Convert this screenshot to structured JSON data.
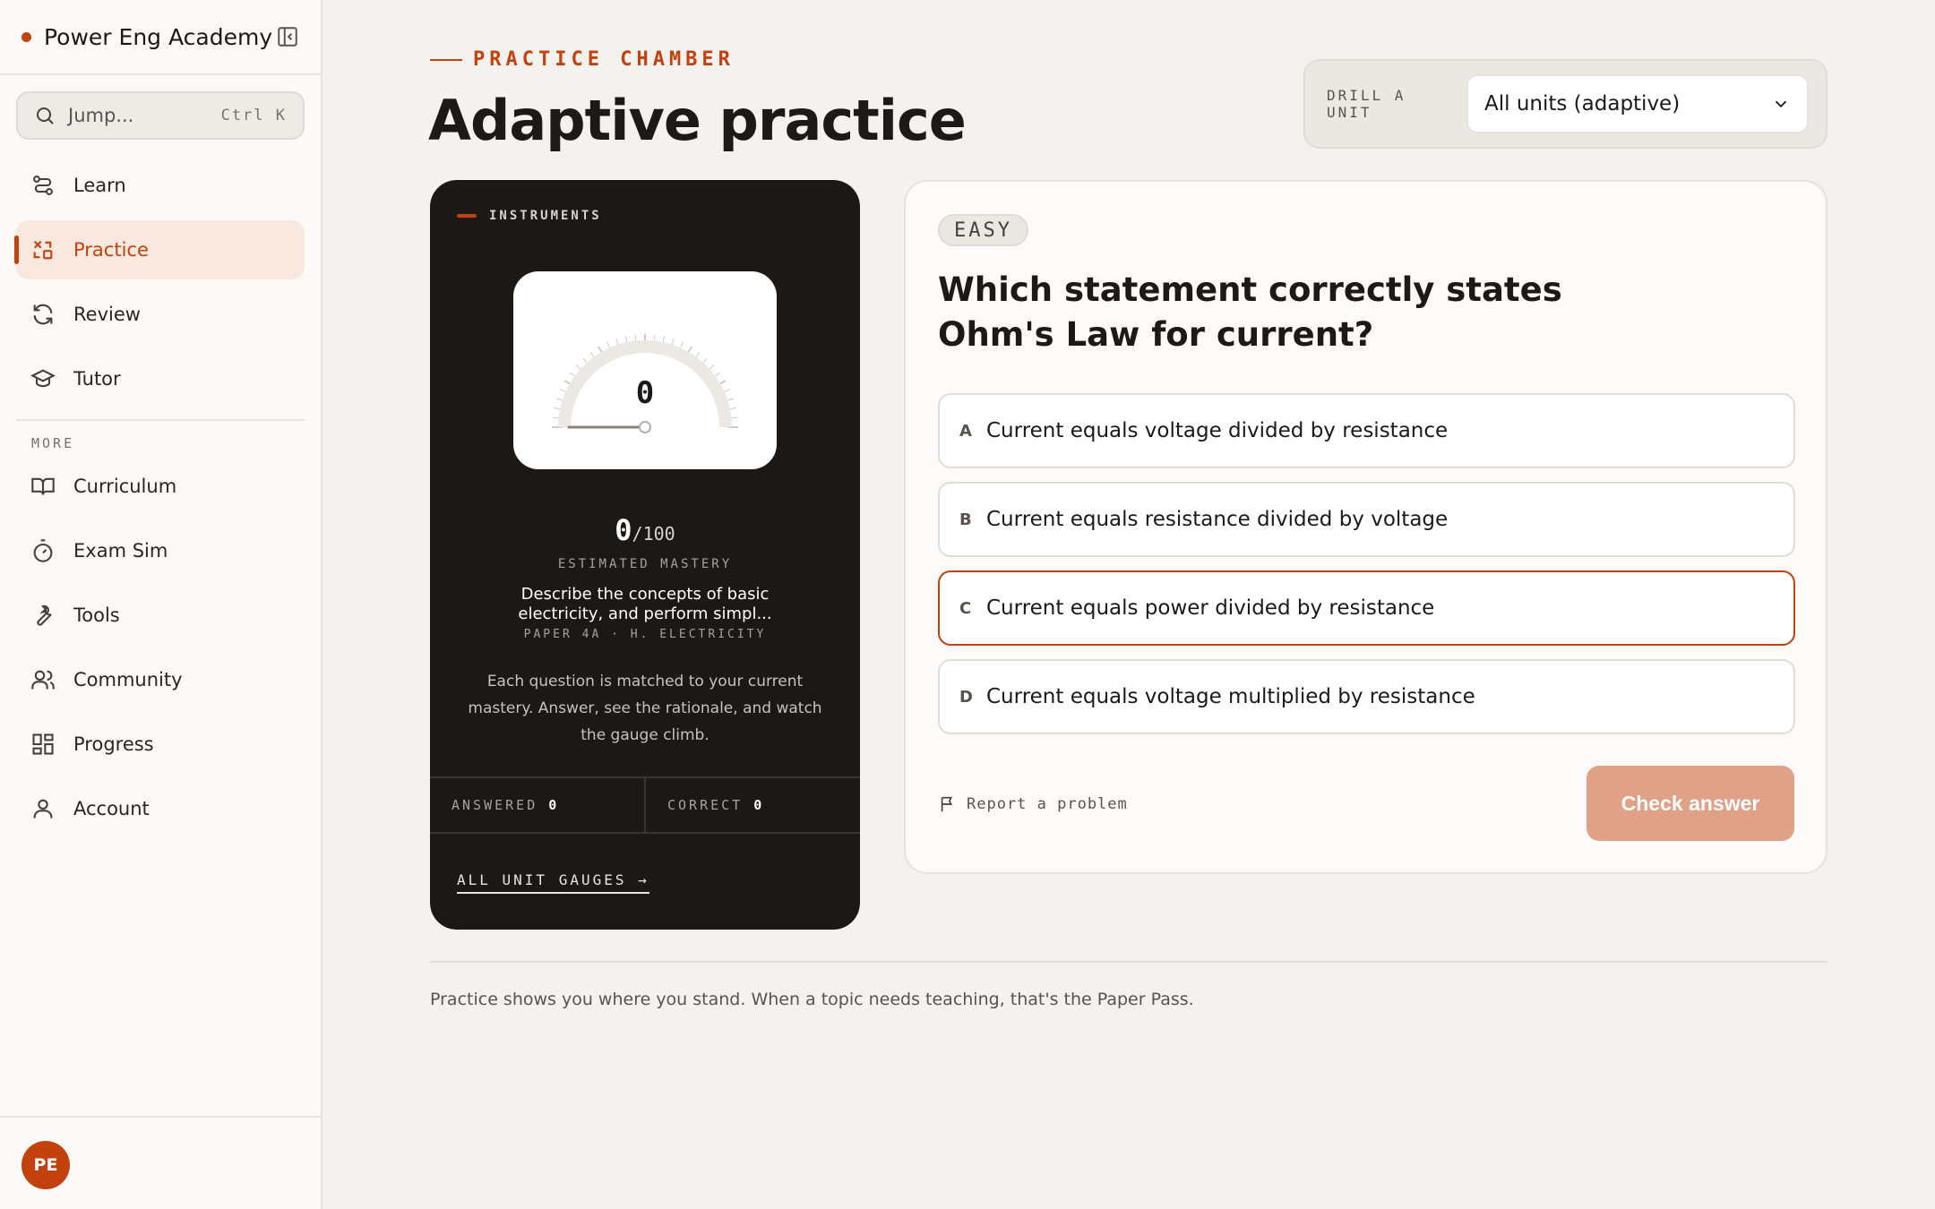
{
  "app": {
    "name": "Power Eng Academy",
    "user_initials": "PE"
  },
  "search": {
    "placeholder": "Jump...",
    "shortcut": "Ctrl K"
  },
  "nav": {
    "primary": [
      {
        "label": "Learn",
        "icon": "route-icon"
      },
      {
        "label": "Practice",
        "icon": "practice-icon",
        "active": true
      },
      {
        "label": "Review",
        "icon": "refresh-icon"
      },
      {
        "label": "Tutor",
        "icon": "graduation-cap-icon"
      }
    ],
    "more_label": "MORE",
    "secondary": [
      {
        "label": "Curriculum",
        "icon": "book-open-icon"
      },
      {
        "label": "Exam Sim",
        "icon": "timer-icon"
      },
      {
        "label": "Tools",
        "icon": "wrench-icon"
      },
      {
        "label": "Community",
        "icon": "users-icon"
      },
      {
        "label": "Progress",
        "icon": "dashboard-icon"
      },
      {
        "label": "Account",
        "icon": "user-icon"
      }
    ]
  },
  "header": {
    "eyebrow": "PRACTICE CHAMBER",
    "title": "Adaptive practice",
    "drill_label": "DRILL A UNIT",
    "drill_value": "All units (adaptive)"
  },
  "instruments": {
    "title": "INSTRUMENTS",
    "gauge_value": "0",
    "gauge_fraction": 0,
    "score": "0",
    "score_max": "/100",
    "mastery_label": "ESTIMATED MASTERY",
    "unit_description": "Describe the concepts of basic electricity, and perform simpl...",
    "unit_code": "PAPER 4A · H. ELECTRICITY",
    "note": "Each question is matched to your current mastery. Answer, see the rationale, and watch the gauge climb.",
    "answered_label": "ANSWERED",
    "answered_value": "0",
    "correct_label": "CORRECT",
    "correct_value": "0",
    "all_gauges_link": "ALL UNIT GAUGES →"
  },
  "question": {
    "difficulty": "EASY",
    "text": "Which statement correctly states Ohm's Law for current?",
    "options": [
      {
        "letter": "A",
        "text": "Current equals voltage divided by resistance"
      },
      {
        "letter": "B",
        "text": "Current equals resistance divided by voltage"
      },
      {
        "letter": "C",
        "text": "Current equals power divided by resistance"
      },
      {
        "letter": "D",
        "text": "Current equals voltage multiplied by resistance"
      }
    ],
    "report_label": "Report a problem",
    "check_label": "Check answer"
  },
  "footer": {
    "text": "Practice shows you where you stand. When a topic needs teaching, that's the Paper Pass."
  },
  "colors": {
    "accent": "#c2410c",
    "check_button": "#e0a187",
    "dark_card": "#1c1816"
  }
}
